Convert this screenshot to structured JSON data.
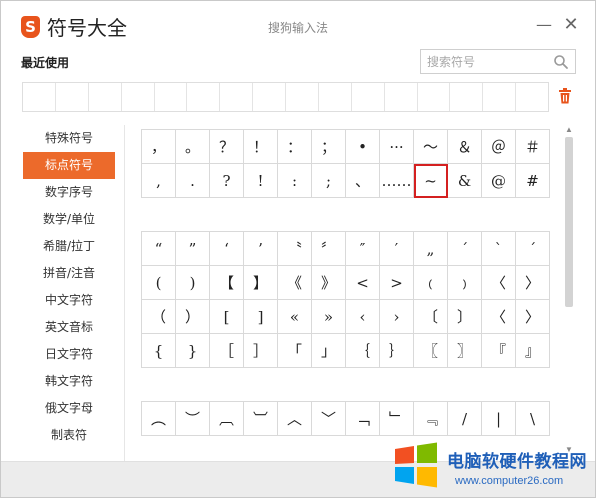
{
  "app": {
    "logo_letter": "S",
    "title": "符号大全",
    "window_title": "搜狗输入法",
    "min_label": "—",
    "close_label": "✕"
  },
  "recent": {
    "label": "最近使用",
    "cell_count": 16
  },
  "search": {
    "placeholder": "搜索符号"
  },
  "sidebar": {
    "items": [
      {
        "label": "特殊符号",
        "active": false
      },
      {
        "label": "标点符号",
        "active": true
      },
      {
        "label": "数字序号",
        "active": false
      },
      {
        "label": "数学/单位",
        "active": false
      },
      {
        "label": "希腊/拉丁",
        "active": false
      },
      {
        "label": "拼音/注音",
        "active": false
      },
      {
        "label": "中文字符",
        "active": false
      },
      {
        "label": "英文音标",
        "active": false
      },
      {
        "label": "日文字符",
        "active": false
      },
      {
        "label": "韩文字符",
        "active": false
      },
      {
        "label": "俄文字母",
        "active": false
      },
      {
        "label": "制表符",
        "active": false
      }
    ]
  },
  "symbols": {
    "selected": {
      "block": 0,
      "row": 1,
      "col": 8
    },
    "blocks": [
      [
        [
          "，",
          "。",
          "？",
          "！",
          "：",
          "；",
          "•",
          "···",
          "～",
          "＆",
          "＠",
          "＃"
        ],
        [
          ",",
          ".",
          "?",
          "!",
          ":",
          ";",
          "、",
          "……",
          "~",
          "&",
          "@",
          "#"
        ]
      ],
      [
        [
          "“",
          "”",
          "‘",
          "’",
          "〝",
          "〞",
          "″",
          "′",
          "„",
          "ˊ",
          "ˋ",
          "ˊ"
        ],
        [
          "(",
          ")",
          "【",
          "】",
          "《",
          "》",
          "<",
          ">",
          "﹙",
          "﹚",
          "〈",
          "〉"
        ],
        [
          "（",
          "）",
          "[",
          "]",
          "«",
          "»",
          "‹",
          "›",
          "〔",
          "〕",
          "〈",
          "〉"
        ],
        [
          "{",
          "}",
          "［",
          "］",
          "「",
          "」",
          "｛",
          "｝",
          "〖",
          "〗",
          "『",
          "』"
        ]
      ],
      [
        [
          "︵",
          "︶",
          "︹",
          "︺",
          "︿",
          "﹀",
          "﹁",
          "﹂",
          "﹃",
          "/",
          "|",
          "\\"
        ]
      ]
    ]
  },
  "watermark": {
    "text": "电脑软硬件教程网",
    "url": "www.computer26.com"
  },
  "colors": {
    "accent": "#ec6a2b",
    "selection_border": "#d42020",
    "grid_line": "#d9d9d9"
  }
}
